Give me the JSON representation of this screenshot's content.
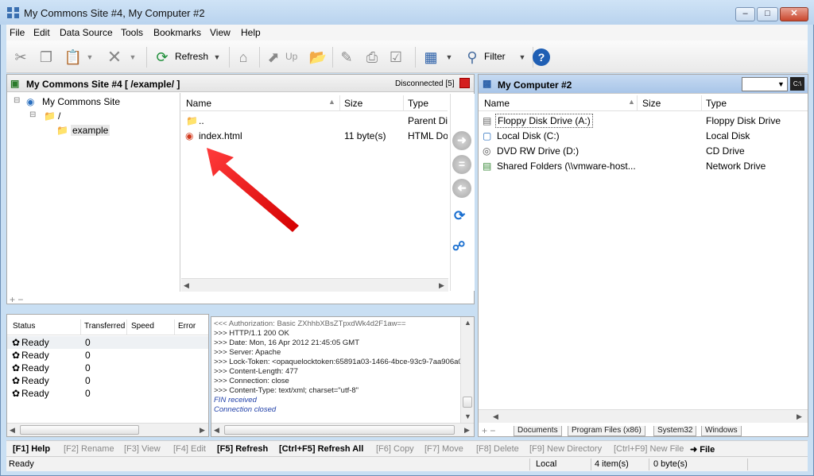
{
  "window": {
    "title": "My Commons Site #4, My Computer #2"
  },
  "menu": [
    "File",
    "Edit",
    "Data Source",
    "Tools",
    "Bookmarks",
    "View",
    "Help"
  ],
  "toolbar": {
    "refresh_label": "Refresh",
    "up_label": "Up",
    "filter_label": "Filter"
  },
  "left_pane": {
    "site_label": "My Commons Site #4",
    "path": "[ /example/ ]",
    "status": "Disconnected [5]",
    "tree": [
      "My Commons Site",
      "/",
      "example"
    ],
    "columns": {
      "name": "Name",
      "size": "Size",
      "type": "Type"
    },
    "files": [
      {
        "name": "..",
        "size": "",
        "type": "Parent Di"
      },
      {
        "name": "index.html",
        "size": "11 byte(s)",
        "type": "HTML Do"
      }
    ]
  },
  "right_pane": {
    "title": "My Computer #2",
    "columns": {
      "name": "Name",
      "size": "Size",
      "type": "Type"
    },
    "drives": [
      {
        "name": "Floppy Disk Drive (A:)",
        "type": "Floppy Disk Drive"
      },
      {
        "name": "Local Disk (C:)",
        "type": "Local Disk"
      },
      {
        "name": "DVD RW Drive (D:)",
        "type": "CD Drive"
      },
      {
        "name": "Shared Folders (\\\\vmware-host...",
        "type": "Network Drive"
      }
    ],
    "tabs": [
      "Documents",
      "Program Files (x86)",
      "System32",
      "Windows"
    ]
  },
  "transfers": {
    "columns": {
      "status": "Status",
      "transferred": "Transferred",
      "speed": "Speed",
      "error": "Error"
    },
    "rows": [
      {
        "status": "Ready",
        "transferred": "0"
      },
      {
        "status": "Ready",
        "transferred": "0"
      },
      {
        "status": "Ready",
        "transferred": "0"
      },
      {
        "status": "Ready",
        "transferred": "0"
      },
      {
        "status": "Ready",
        "transferred": "0"
      }
    ]
  },
  "log": [
    "<<< Authorization: Basic ZXhhbXBsZTpxdWk4d2F1aw==",
    ">>> HTTP/1.1 200 OK",
    ">>> Date: Mon, 16 Apr 2012 21:45:05 GMT",
    ">>> Server: Apache",
    ">>> Lock-Token: <opaquelocktoken:65891a03-1466-4bce-93c9-7aa906a0ab",
    ">>> Content-Length: 477",
    ">>> Connection: close",
    ">>> Content-Type: text/xml; charset=\"utf-8\"",
    "FIN received",
    "Connection closed"
  ],
  "fkeys": [
    "[F1] Help",
    "[F2] Rename",
    "[F3] View",
    "[F4] Edit",
    "[F5] Refresh",
    "[Ctrl+F5] Refresh All",
    "[F6] Copy",
    "[F7] Move",
    "[F8] Delete",
    "[F9] New Directory",
    "[Ctrl+F9] New File",
    "File"
  ],
  "statusbar": {
    "left": "Ready",
    "location": "Local",
    "items": "4 item(s)",
    "bytes": "0 byte(s)"
  }
}
